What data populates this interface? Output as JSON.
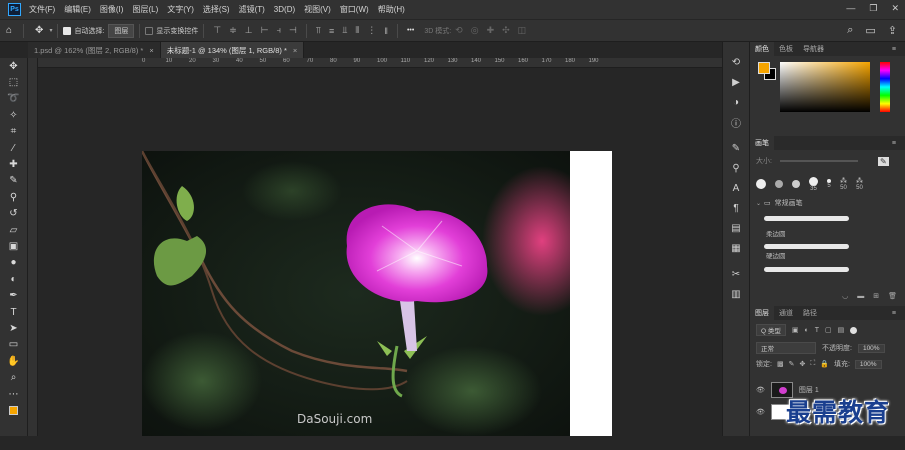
{
  "menubar": {
    "logo": "Ps",
    "items": [
      "文件(F)",
      "编辑(E)",
      "图像(I)",
      "图层(L)",
      "文字(Y)",
      "选择(S)",
      "滤镜(T)",
      "3D(D)",
      "视图(V)",
      "窗口(W)",
      "帮助(H)"
    ]
  },
  "options": {
    "auto_select_label": "自动选择:",
    "auto_select_value": "图层",
    "show_transform_label": "显示变换控件",
    "mode_3d_label": "3D 模式:",
    "more": "•••"
  },
  "tabs": [
    {
      "label": "1.psd @ 162% (图层 2, RGB/8) *",
      "close": "×"
    },
    {
      "label": "未标题-1 @ 134% (图层 1, RGB/8) *",
      "close": "×"
    }
  ],
  "ruler": {
    "ticks": [
      "0",
      "10",
      "20",
      "30",
      "40",
      "50",
      "60",
      "70",
      "80",
      "90",
      "100",
      "110",
      "120",
      "130",
      "140",
      "150",
      "160",
      "170",
      "180",
      "190"
    ]
  },
  "canvas": {
    "watermark": "DaSouji.com"
  },
  "color_panel": {
    "tabs": [
      "颜色",
      "色板",
      "导航器"
    ],
    "fg": "#f5a400",
    "bg": "#000000"
  },
  "brush_panel": {
    "title": "画笔",
    "size_label": "大小:",
    "preset_sizes": [
      "35",
      "5",
      "50",
      "50"
    ],
    "group": "常规画笔",
    "items": [
      "柔边圆",
      "硬边圆"
    ]
  },
  "layers_panel": {
    "tabs": [
      "图层",
      "通道",
      "路径"
    ],
    "filter": "Q 类型",
    "blend_mode": "正常",
    "opacity_label": "不透明度:",
    "opacity_value": "100%",
    "lock_label": "锁定:",
    "fill_label": "填充:",
    "fill_value": "100%",
    "layer1_name": "图层 1"
  },
  "brand_watermark": "最需教育",
  "colors": {
    "accent": "#31a8ff",
    "panel": "#323232",
    "workspace": "#262626"
  }
}
